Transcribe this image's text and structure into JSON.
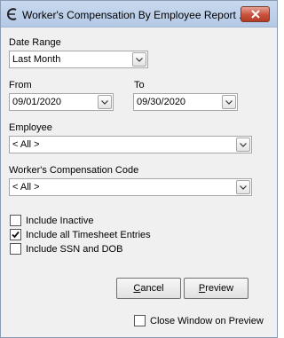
{
  "window": {
    "title": "Worker's Compensation By Employee Report ..."
  },
  "date_range": {
    "label": "Date Range",
    "value": "Last Month"
  },
  "from": {
    "label": "From",
    "value": "09/01/2020"
  },
  "to": {
    "label": "To",
    "value": "09/30/2020"
  },
  "employee": {
    "label": "Employee",
    "value": "< All >"
  },
  "wc_code": {
    "label": "Worker's Compensation Code",
    "value": "< All >"
  },
  "options": {
    "include_inactive": {
      "label": "Include Inactive",
      "checked": false
    },
    "include_timesheet": {
      "label": "Include all Timesheet Entries",
      "checked": true
    },
    "include_ssn": {
      "label": "Include SSN and DOB",
      "checked": false
    }
  },
  "buttons": {
    "cancel": {
      "first": "C",
      "rest": "ancel"
    },
    "preview": {
      "first": "P",
      "rest": "review"
    }
  },
  "close_on_preview": {
    "label": "Close Window on Preview",
    "checked": false
  }
}
